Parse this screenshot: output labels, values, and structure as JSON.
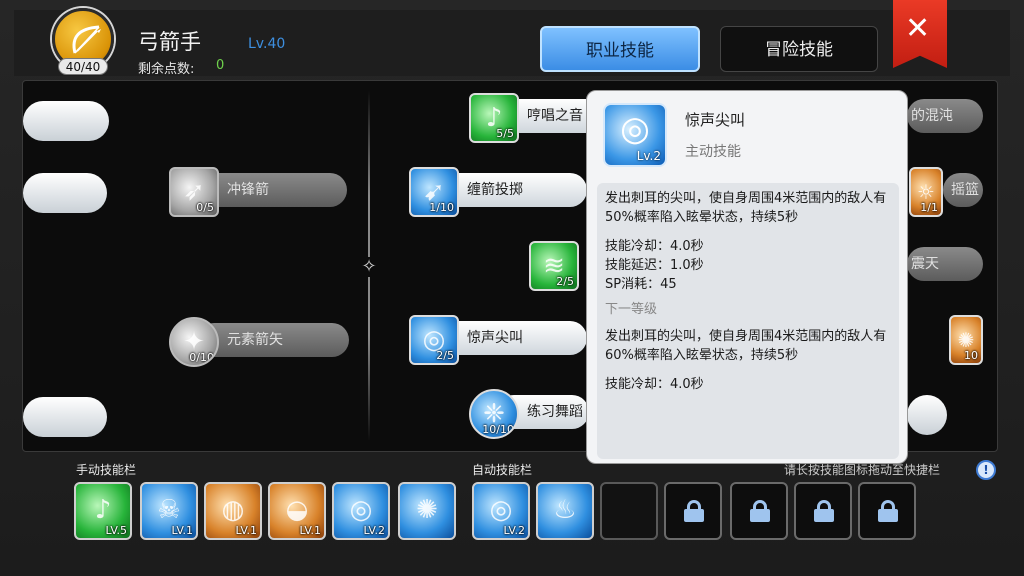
{
  "header": {
    "class_name": "弓箭手",
    "class_level": "Lv.40",
    "avatar_points": "40/40",
    "points_label": "剩余点数:",
    "points_value": "0"
  },
  "tabs": [
    {
      "label": "职业技能",
      "active": true
    },
    {
      "label": "冒险技能",
      "active": false
    }
  ],
  "close_label": "✕",
  "tree": {
    "left_nodes": [
      {
        "name": "冲锋箭",
        "count": "0/5",
        "icon": "arrow-burst-icon",
        "state": "locked"
      },
      {
        "name": "元素箭矢",
        "count": "0/10",
        "icon": "elemental-arrow-icon",
        "state": "locked"
      }
    ],
    "right_nodes": [
      {
        "name": "哼唱之音",
        "count": "5/5",
        "icon": "singing-icon",
        "color": "green"
      },
      {
        "name": "缠箭投掷",
        "count": "1/10",
        "icon": "arrow-throw-icon",
        "color": "blue"
      },
      {
        "name": "",
        "count": "2/5",
        "icon": "wind-icon",
        "color": "green"
      },
      {
        "name": "惊声尖叫",
        "count": "2/5",
        "icon": "scream-icon",
        "color": "blue"
      },
      {
        "name": "练习舞蹈",
        "count": "10/10",
        "icon": "dance-icon",
        "color": "blue"
      },
      {
        "name": "的混沌",
        "count": "",
        "icon": "",
        "color": "none"
      },
      {
        "name": "摇篮",
        "count": "1/1",
        "icon": "cradle-icon",
        "color": "orange"
      },
      {
        "name": "震天",
        "count": "",
        "icon": "",
        "color": "none"
      },
      {
        "name": "",
        "count": "10",
        "icon": "dancer-icon",
        "color": "orange"
      }
    ]
  },
  "tooltip": {
    "skill_name": "惊声尖叫",
    "skill_type": "主动技能",
    "icon_level": "Lv.2",
    "description": "发出刺耳的尖叫，使自身周围4米范围内的敌人有50%概率陷入眩晕状态，持续5秒",
    "cooldown": "技能冷却：4.0秒",
    "delay": "技能延迟：1.0秒",
    "sp_cost": "SP消耗：45",
    "next_level_label": "下一等级",
    "next_description": "发出刺耳的尖叫，使自身周围4米范围内的敌人有60%概率陷入眩晕状态，持续5秒",
    "next_cooldown": "技能冷却：4.0秒"
  },
  "bottom": {
    "manual_label": "手动技能栏",
    "auto_label": "自动技能栏",
    "hint": "请长按技能图标拖动至快捷栏",
    "info_icon": "!",
    "manual_slots": [
      {
        "level": "LV.5",
        "icon": "singing-icon",
        "color": "green"
      },
      {
        "level": "LV.1",
        "icon": "skull-icon",
        "color": "blue"
      },
      {
        "level": "LV.1",
        "icon": "ring-icon",
        "color": "orange"
      },
      {
        "level": "LV.1",
        "icon": "bell-icon",
        "color": "orange"
      },
      {
        "level": "LV.2",
        "icon": "scream-icon",
        "color": "blue"
      },
      {
        "level": "",
        "icon": "dancer-icon",
        "color": "blue"
      }
    ],
    "auto_slots": [
      {
        "level": "LV.2",
        "icon": "scream-icon",
        "color": "blue"
      },
      {
        "level": "",
        "icon": "rest-icon",
        "color": "blue"
      }
    ]
  }
}
